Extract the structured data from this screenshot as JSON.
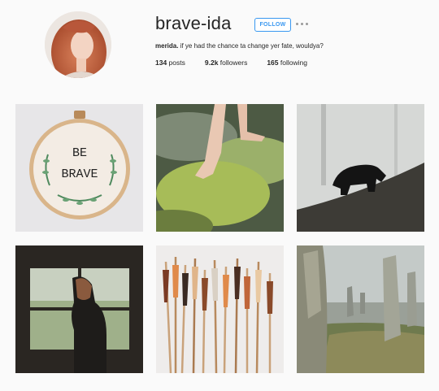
{
  "profile": {
    "username": "brave-ida",
    "follow_label": "FOLLOW",
    "bio_name": "merida.",
    "bio_text": " if ye had the chance ta change yer fate, wouldya?",
    "posts_count": "134",
    "posts_label": " posts",
    "followers_count": "9.2k",
    "followers_label": " followers",
    "following_count": "165",
    "following_label": " following"
  },
  "grid": {
    "hoop_text_line1": "BE",
    "hoop_text_line2": "BRAVE"
  }
}
